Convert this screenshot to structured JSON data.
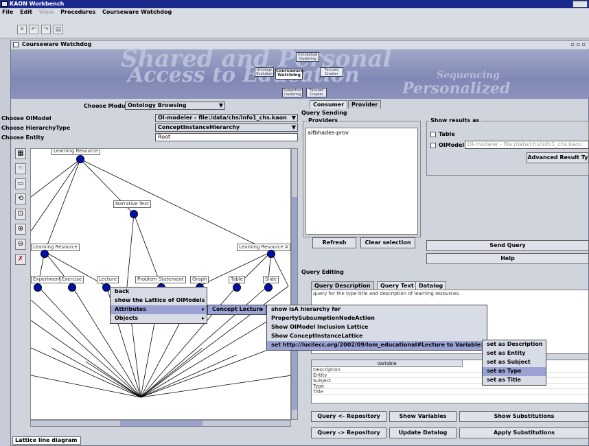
{
  "app": {
    "title": "KAON Workbench"
  },
  "menubar": {
    "file": "File",
    "edit": "Edit",
    "view": "View",
    "procedures": "Procedures",
    "courseware": "Courseware Watchdog"
  },
  "frame": {
    "title": "Courseware Watchdog"
  },
  "banner": {
    "words": [
      "Shared and Personal",
      "Access to Education",
      "Sequencing",
      "Personalized"
    ],
    "center_logo": "Courseware Watchdog",
    "boxes": [
      "Conceptual Clustering",
      "Ontology Evolution",
      "Focused Crawler",
      "Subjective Clustering",
      "Focused Crawler"
    ]
  },
  "left": {
    "choose_modus_label": "Choose Modus",
    "choose_modus_value": "Ontology Browsing",
    "choose_oimodel_label": "Choose OIModel",
    "choose_oimodel_value": "OI-modeler - file:/data/chs/info1_chs.kaon",
    "choose_hierarchy_label": "Choose HierarchyType",
    "choose_hierarchy_value": "ConceptInstanceHierarchy",
    "choose_entity_label": "Choose Entity",
    "choose_entity_value": "Root",
    "bottom_tab": "Lattice line diagram"
  },
  "graph": {
    "labels": [
      "Learning Resource",
      "Narrative Text",
      "Learning Resource",
      "Learning Resource A",
      "Experiment",
      "Exercise",
      "Lecture",
      "Problem Statement",
      "Graph",
      "Table",
      "Slide"
    ]
  },
  "context_menu": {
    "items": [
      "back",
      "show the Lattice of OIModels",
      "Attributes",
      "Objects"
    ],
    "sub1": [
      "Concept Lecture"
    ],
    "sub2": [
      "show isA hierarchy for",
      "PropertySubsumptionNodeAction",
      "Show OIModel Inclusion Lattice",
      "Show ConceptInstanceLattice",
      "set http://lucilecc.org/2002/09/lom_educational#Lecture to Variable:"
    ],
    "sub3": [
      "set as Description",
      "set as Entity",
      "set as Subject",
      "set as Type",
      "set as Title"
    ]
  },
  "right": {
    "tabs": [
      "Consumer",
      "Provider"
    ],
    "query_sending": "Query Sending",
    "providers_title": "Providers",
    "providers": [
      "aifbhades-prov"
    ],
    "show_results_title": "Show results as",
    "table_opt": "Table",
    "oimodel_opt": "OIModel",
    "oimodel_field": "OI-modeler - file:/data/chs/info1_chs.kaon",
    "advanced_btn": "Advanced Result Ty",
    "refresh_btn": "Refresh",
    "clear_btn": "Clear selection",
    "send_btn": "Send Query",
    "help_btn": "Help",
    "query_editing": "Query Editing",
    "edit_tabs": [
      "Query Description",
      "Query Text",
      "Datalog"
    ],
    "query_text": "query for the type title and description of learning resources.",
    "variable_header": "Variable",
    "variables": [
      "Description",
      "Entity",
      "Subject",
      "Type",
      "Title"
    ],
    "btns": [
      "Query <- Repository",
      "Show Variables",
      "Show Substitutions",
      "Query -> Repository",
      "Update Datalog",
      "Apply Substitutions"
    ]
  }
}
